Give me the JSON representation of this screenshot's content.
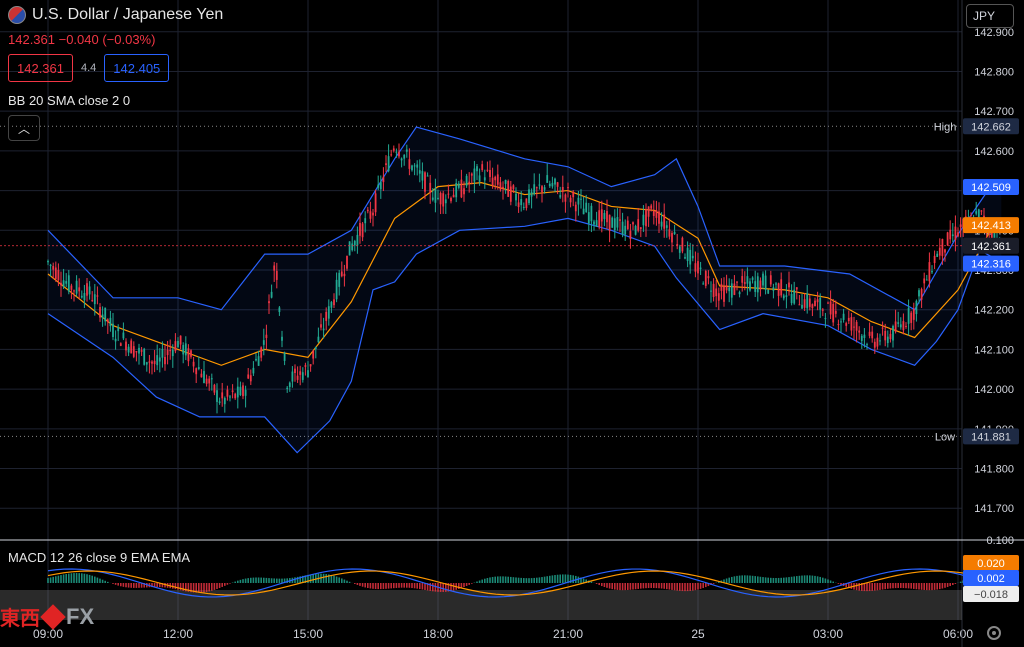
{
  "header": {
    "symbol_title": "U.S. Dollar / Japanese Yen",
    "quote_line": "142.361  −0.040 (−0.03%)",
    "bid": "142.361",
    "ask": "142.405",
    "spread": "4.4",
    "currency_selector": "JPY"
  },
  "indicators": {
    "bb_label": "BB 20 SMA close 2 0",
    "macd_label": "MACD 12 26 close 9 EMA EMA"
  },
  "logo": {
    "cn": "東西",
    "fx": "FX"
  },
  "colors": {
    "up": "#22ab94",
    "down": "#f23645",
    "bb_band": "#2962ff",
    "sma": "#ff9800",
    "grid": "#1e2230",
    "label_blue": "#2962ff",
    "label_orange": "#f57c00"
  },
  "chart_data": [
    {
      "type": "candlestick",
      "title": "U.S. Dollar / Japanese Yen",
      "ylim": [
        141.62,
        142.98
      ],
      "yticks": [
        "142.900",
        "142.800",
        "142.700",
        "142.600",
        "142.500",
        "142.400",
        "142.300",
        "142.200",
        "142.100",
        "142.000",
        "141.900",
        "141.800",
        "141.700"
      ],
      "xticks": [
        "09:00",
        "12:00",
        "15:00",
        "18:00",
        "21:00",
        "25",
        "03:00",
        "06:00"
      ],
      "high": {
        "label": "High",
        "value": "142.662"
      },
      "low": {
        "label": "Low",
        "value": "141.881"
      },
      "price_labels": [
        {
          "value": "142.509",
          "role": "bb-upper"
        },
        {
          "value": "142.413",
          "role": "sma"
        },
        {
          "value": "142.361",
          "role": "last"
        },
        {
          "value": "142.316",
          "role": "bb-lower"
        }
      ],
      "close_path": [
        {
          "x": "09:00",
          "y": 142.32
        },
        {
          "x": "09:30",
          "y": 142.26
        },
        {
          "x": "10:00",
          "y": 142.24
        },
        {
          "x": "10:30",
          "y": 142.15
        },
        {
          "x": "11:00",
          "y": 142.1
        },
        {
          "x": "11:30",
          "y": 142.06
        },
        {
          "x": "12:00",
          "y": 142.12
        },
        {
          "x": "12:30",
          "y": 142.05
        },
        {
          "x": "13:00",
          "y": 141.97
        },
        {
          "x": "13:30",
          "y": 141.99
        },
        {
          "x": "14:00",
          "y": 142.12
        },
        {
          "x": "14:15",
          "y": 142.33
        },
        {
          "x": "14:30",
          "y": 142.02
        },
        {
          "x": "15:00",
          "y": 142.05
        },
        {
          "x": "15:30",
          "y": 142.2
        },
        {
          "x": "16:00",
          "y": 142.36
        },
        {
          "x": "16:30",
          "y": 142.45
        },
        {
          "x": "17:00",
          "y": 142.62
        },
        {
          "x": "17:30",
          "y": 142.55
        },
        {
          "x": "18:00",
          "y": 142.48
        },
        {
          "x": "18:30",
          "y": 142.5
        },
        {
          "x": "19:00",
          "y": 142.55
        },
        {
          "x": "19:30",
          "y": 142.51
        },
        {
          "x": "20:00",
          "y": 142.47
        },
        {
          "x": "20:30",
          "y": 142.52
        },
        {
          "x": "21:00",
          "y": 142.49
        },
        {
          "x": "21:30",
          "y": 142.44
        },
        {
          "x": "22:00",
          "y": 142.42
        },
        {
          "x": "22:30",
          "y": 142.4
        },
        {
          "x": "23:00",
          "y": 142.45
        },
        {
          "x": "23:30",
          "y": 142.38
        },
        {
          "x": "00:00",
          "y": 142.3
        },
        {
          "x": "00:30",
          "y": 142.24
        },
        {
          "x": "01:00",
          "y": 142.26
        },
        {
          "x": "01:30",
          "y": 142.27
        },
        {
          "x": "02:00",
          "y": 142.25
        },
        {
          "x": "02:30",
          "y": 142.22
        },
        {
          "x": "03:00",
          "y": 142.2
        },
        {
          "x": "03:30",
          "y": 142.17
        },
        {
          "x": "04:00",
          "y": 142.12
        },
        {
          "x": "04:30",
          "y": 142.14
        },
        {
          "x": "05:00",
          "y": 142.2
        },
        {
          "x": "05:30",
          "y": 142.34
        },
        {
          "x": "06:00",
          "y": 142.4
        },
        {
          "x": "06:30",
          "y": 142.44
        },
        {
          "x": "07:00",
          "y": 142.36
        }
      ],
      "bb_upper": [
        {
          "x": "09:00",
          "y": 142.4
        },
        {
          "x": "10:30",
          "y": 142.23
        },
        {
          "x": "12:00",
          "y": 142.23
        },
        {
          "x": "13:00",
          "y": 142.2
        },
        {
          "x": "14:00",
          "y": 142.34
        },
        {
          "x": "15:00",
          "y": 142.34
        },
        {
          "x": "16:00",
          "y": 142.4
        },
        {
          "x": "17:00",
          "y": 142.58
        },
        {
          "x": "17:30",
          "y": 142.66
        },
        {
          "x": "18:30",
          "y": 142.63
        },
        {
          "x": "20:00",
          "y": 142.58
        },
        {
          "x": "21:00",
          "y": 142.56
        },
        {
          "x": "22:00",
          "y": 142.51
        },
        {
          "x": "23:00",
          "y": 142.54
        },
        {
          "x": "23:30",
          "y": 142.58
        },
        {
          "x": "00:00",
          "y": 142.46
        },
        {
          "x": "00:30",
          "y": 142.31
        },
        {
          "x": "02:00",
          "y": 142.31
        },
        {
          "x": "03:30",
          "y": 142.29
        },
        {
          "x": "05:00",
          "y": 142.2
        },
        {
          "x": "06:00",
          "y": 142.39
        },
        {
          "x": "06:45",
          "y": 142.51
        },
        {
          "x": "07:00",
          "y": 142.51
        }
      ],
      "bb_lower": [
        {
          "x": "09:00",
          "y": 142.19
        },
        {
          "x": "10:30",
          "y": 142.08
        },
        {
          "x": "11:30",
          "y": 141.98
        },
        {
          "x": "12:30",
          "y": 141.93
        },
        {
          "x": "14:00",
          "y": 141.93
        },
        {
          "x": "14:45",
          "y": 141.84
        },
        {
          "x": "15:30",
          "y": 141.92
        },
        {
          "x": "16:00",
          "y": 142.02
        },
        {
          "x": "16:30",
          "y": 142.25
        },
        {
          "x": "17:00",
          "y": 142.27
        },
        {
          "x": "17:30",
          "y": 142.34
        },
        {
          "x": "18:30",
          "y": 142.4
        },
        {
          "x": "20:00",
          "y": 142.41
        },
        {
          "x": "21:00",
          "y": 142.43
        },
        {
          "x": "22:00",
          "y": 142.4
        },
        {
          "x": "23:00",
          "y": 142.36
        },
        {
          "x": "23:30",
          "y": 142.28
        },
        {
          "x": "00:30",
          "y": 142.15
        },
        {
          "x": "01:30",
          "y": 142.19
        },
        {
          "x": "03:00",
          "y": 142.16
        },
        {
          "x": "04:00",
          "y": 142.1
        },
        {
          "x": "05:00",
          "y": 142.06
        },
        {
          "x": "05:30",
          "y": 142.12
        },
        {
          "x": "06:00",
          "y": 142.2
        },
        {
          "x": "06:30",
          "y": 142.35
        },
        {
          "x": "07:00",
          "y": 142.32
        }
      ],
      "sma20": [
        {
          "x": "09:00",
          "y": 142.29
        },
        {
          "x": "10:30",
          "y": 142.16
        },
        {
          "x": "12:00",
          "y": 142.1
        },
        {
          "x": "13:00",
          "y": 142.06
        },
        {
          "x": "14:00",
          "y": 142.1
        },
        {
          "x": "15:00",
          "y": 142.08
        },
        {
          "x": "16:00",
          "y": 142.22
        },
        {
          "x": "17:00",
          "y": 142.43
        },
        {
          "x": "18:00",
          "y": 142.51
        },
        {
          "x": "19:00",
          "y": 142.52
        },
        {
          "x": "20:00",
          "y": 142.49
        },
        {
          "x": "21:00",
          "y": 142.5
        },
        {
          "x": "22:00",
          "y": 142.46
        },
        {
          "x": "23:00",
          "y": 142.45
        },
        {
          "x": "00:00",
          "y": 142.38
        },
        {
          "x": "00:30",
          "y": 142.26
        },
        {
          "x": "02:00",
          "y": 142.25
        },
        {
          "x": "03:00",
          "y": 142.23
        },
        {
          "x": "04:00",
          "y": 142.17
        },
        {
          "x": "05:00",
          "y": 142.13
        },
        {
          "x": "06:00",
          "y": 142.25
        },
        {
          "x": "06:45",
          "y": 142.4
        },
        {
          "x": "07:00",
          "y": 142.41
        }
      ]
    },
    {
      "type": "bar",
      "title": "MACD 12 26 close 9 EMA EMA",
      "yticks": [
        "0.100"
      ],
      "price_labels": [
        {
          "value": "0.020",
          "role": "macd"
        },
        {
          "value": "0.002",
          "role": "signal"
        },
        {
          "value": "−0.018",
          "role": "histogram"
        }
      ]
    }
  ]
}
